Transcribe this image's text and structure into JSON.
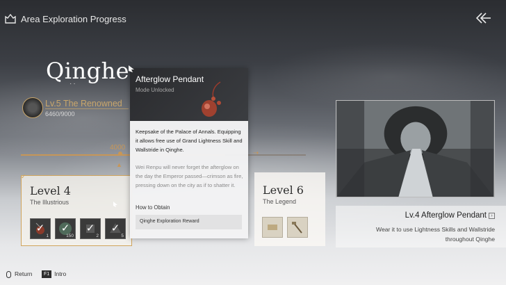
{
  "header": {
    "title": "Area Exploration Progress",
    "icon": "castle-icon",
    "back_icon": "back-arrow-icon"
  },
  "area": {
    "name": "Qinghe",
    "rank_label": "Lv.5 The Renowned",
    "progress_text": "6460/9000",
    "progress_current": 6460,
    "progress_max": 9000
  },
  "track": {
    "marker_label": "4000"
  },
  "level4": {
    "title": "Level 4",
    "subtitle": "The Illustrious",
    "items": [
      {
        "count": "1"
      },
      {
        "count": "150"
      },
      {
        "count": "2"
      },
      {
        "count": "5"
      }
    ]
  },
  "level6": {
    "title": "Level 6",
    "subtitle": "The Legend"
  },
  "tooltip": {
    "name": "Afterglow Pendant",
    "status": "Mode Unlocked",
    "description": "Keepsake of the Palace of Annals. Equipping it allows free use of Grand Lightness Skill and Wallstride in Qinghe.",
    "lore": "Wei Renpu will never forget the afterglow on the day the Emperor passed—crimson as fire, pressing down on the city as if to shatter it.",
    "obtain_label": "How to Obtain",
    "obtain_source": "Qinghe Exploration Reward"
  },
  "detail": {
    "title": "Lv.4 Afterglow Pendant",
    "description": "Wear it to use Lightness Skills and Wallstride throughout Qinghe"
  },
  "footer": {
    "return_label": "Return",
    "intro_key": "F1",
    "intro_label": "Intro"
  },
  "colors": {
    "accent_gold": "#c79657",
    "card_border": "#d0a45c"
  }
}
